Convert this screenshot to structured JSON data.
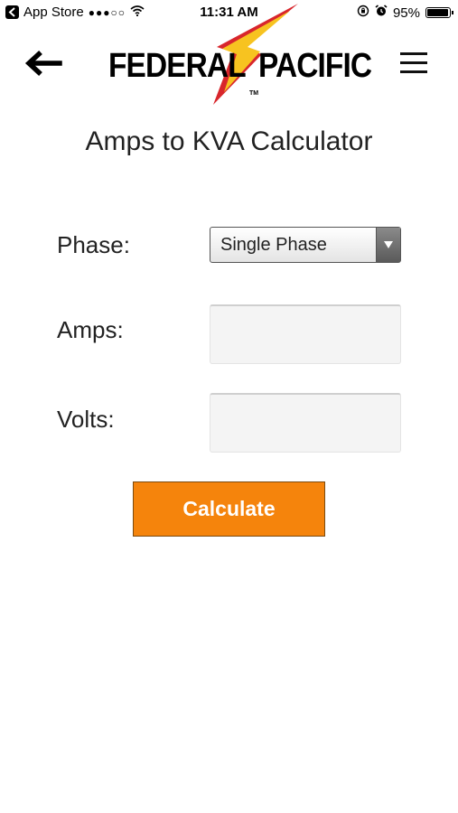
{
  "status_bar": {
    "back_app": "App Store",
    "signal": "●●●○○",
    "time": "11:31 AM",
    "battery_percent": "95%",
    "battery_level": 0.95
  },
  "header": {
    "logo_word_left": "FEDERAL",
    "logo_word_right": "PACIFIC",
    "logo_tm": "TM",
    "icons": {
      "back": "back-arrow-icon",
      "menu": "hamburger-menu-icon",
      "logo_bolt": "lightning-bolt-icon"
    }
  },
  "page": {
    "title": "Amps to KVA Calculator"
  },
  "form": {
    "phase_label": "Phase:",
    "phase_value": "Single Phase",
    "phase_options": [
      "Single Phase"
    ],
    "amps_label": "Amps:",
    "amps_value": "",
    "amps_placeholder": "",
    "volts_label": "Volts:",
    "volts_value": "",
    "volts_placeholder": "",
    "calculate_label": "Calculate"
  },
  "colors": {
    "accent": "#f5840c",
    "bolt_yellow": "#f7c320",
    "bolt_red": "#d8262c"
  }
}
